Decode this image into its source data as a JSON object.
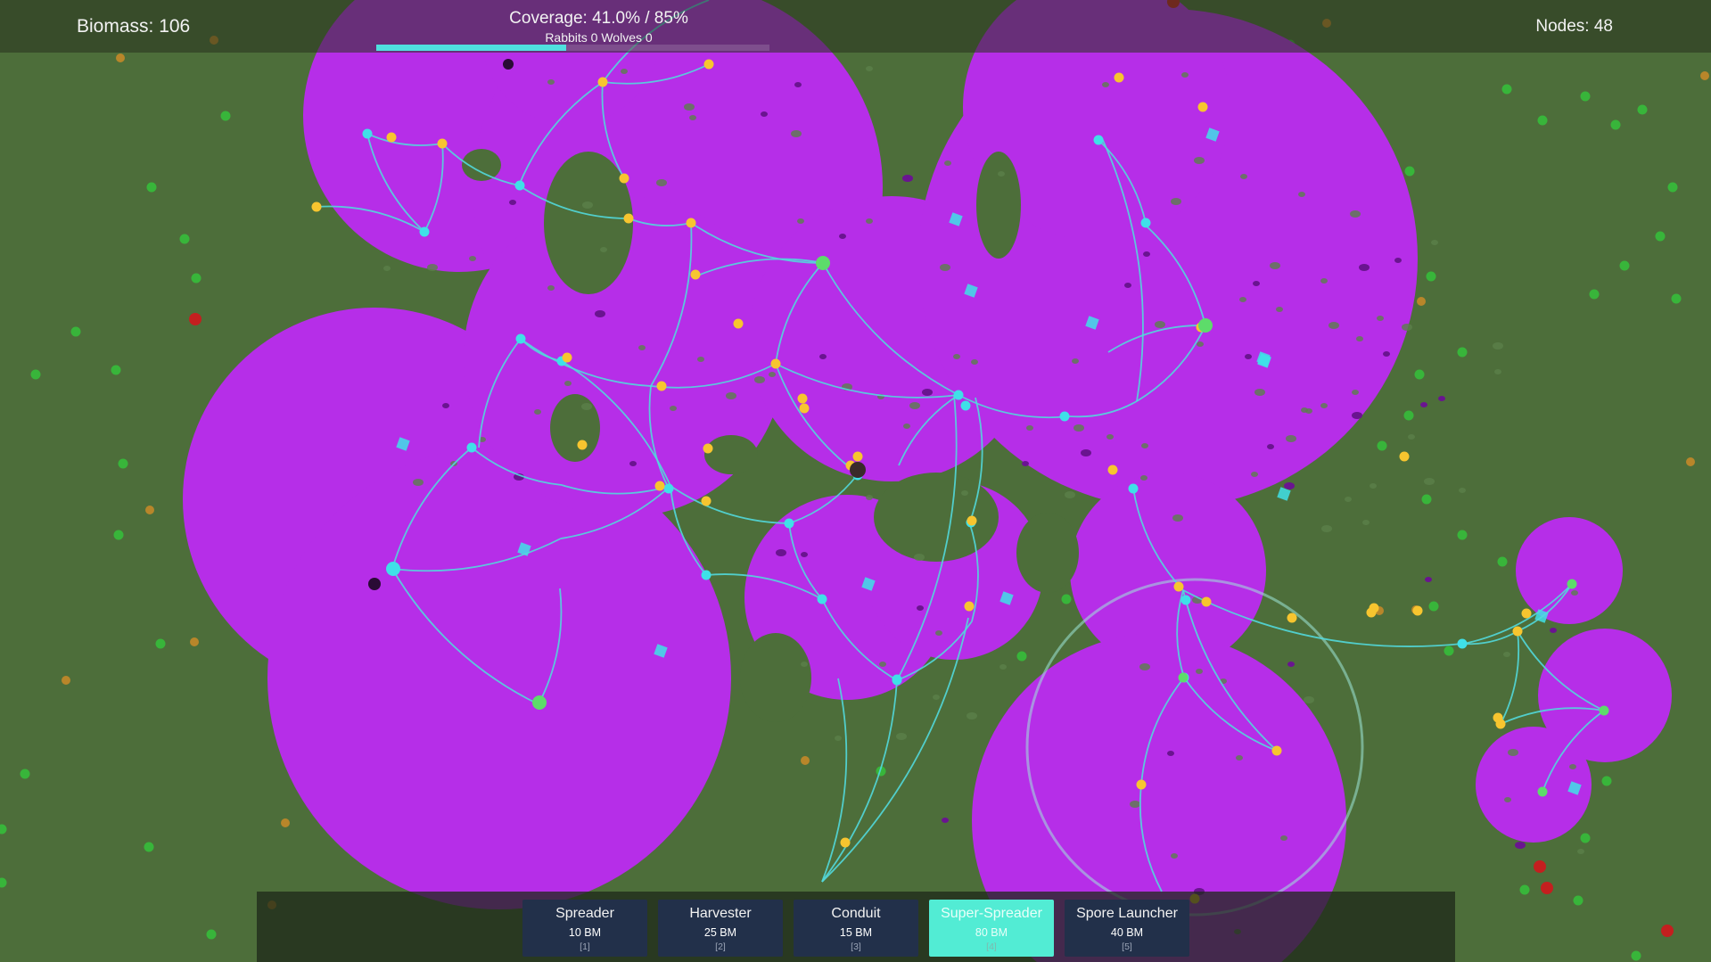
{
  "hud": {
    "biomass": "Biomass: 106",
    "coverage": "Coverage: 41.0%  /  85%",
    "coverage_fraction": 0.41,
    "coverage_target": 0.85,
    "counts": "Rabbits 0  Wolves 0",
    "nodes": "Nodes: 48"
  },
  "toolbar": {
    "tools": [
      {
        "name": "Spreader",
        "cost": "10 BM",
        "key": "[1]"
      },
      {
        "name": "Harvester",
        "cost": "25 BM",
        "key": "[2]"
      },
      {
        "name": "Conduit",
        "cost": "15 BM",
        "key": "[3]"
      },
      {
        "name": "Super-Spreader",
        "cost": "80 BM",
        "key": "[4]"
      },
      {
        "name": "Spore Launcher",
        "cost": "40 BM",
        "key": "[5]"
      }
    ],
    "selected_index": 3
  },
  "colors": {
    "ground": "#4d6e3a",
    "mycelium": "#b62ee8",
    "connection": "#52d8dc",
    "node_cyan": "#3fe0e8",
    "node_yellow": "#f7c52f",
    "node_green": "#5ddc6a",
    "plant": "#38b53a",
    "enemy": "#c41f1f",
    "spore_dark": "#6a1490"
  }
}
